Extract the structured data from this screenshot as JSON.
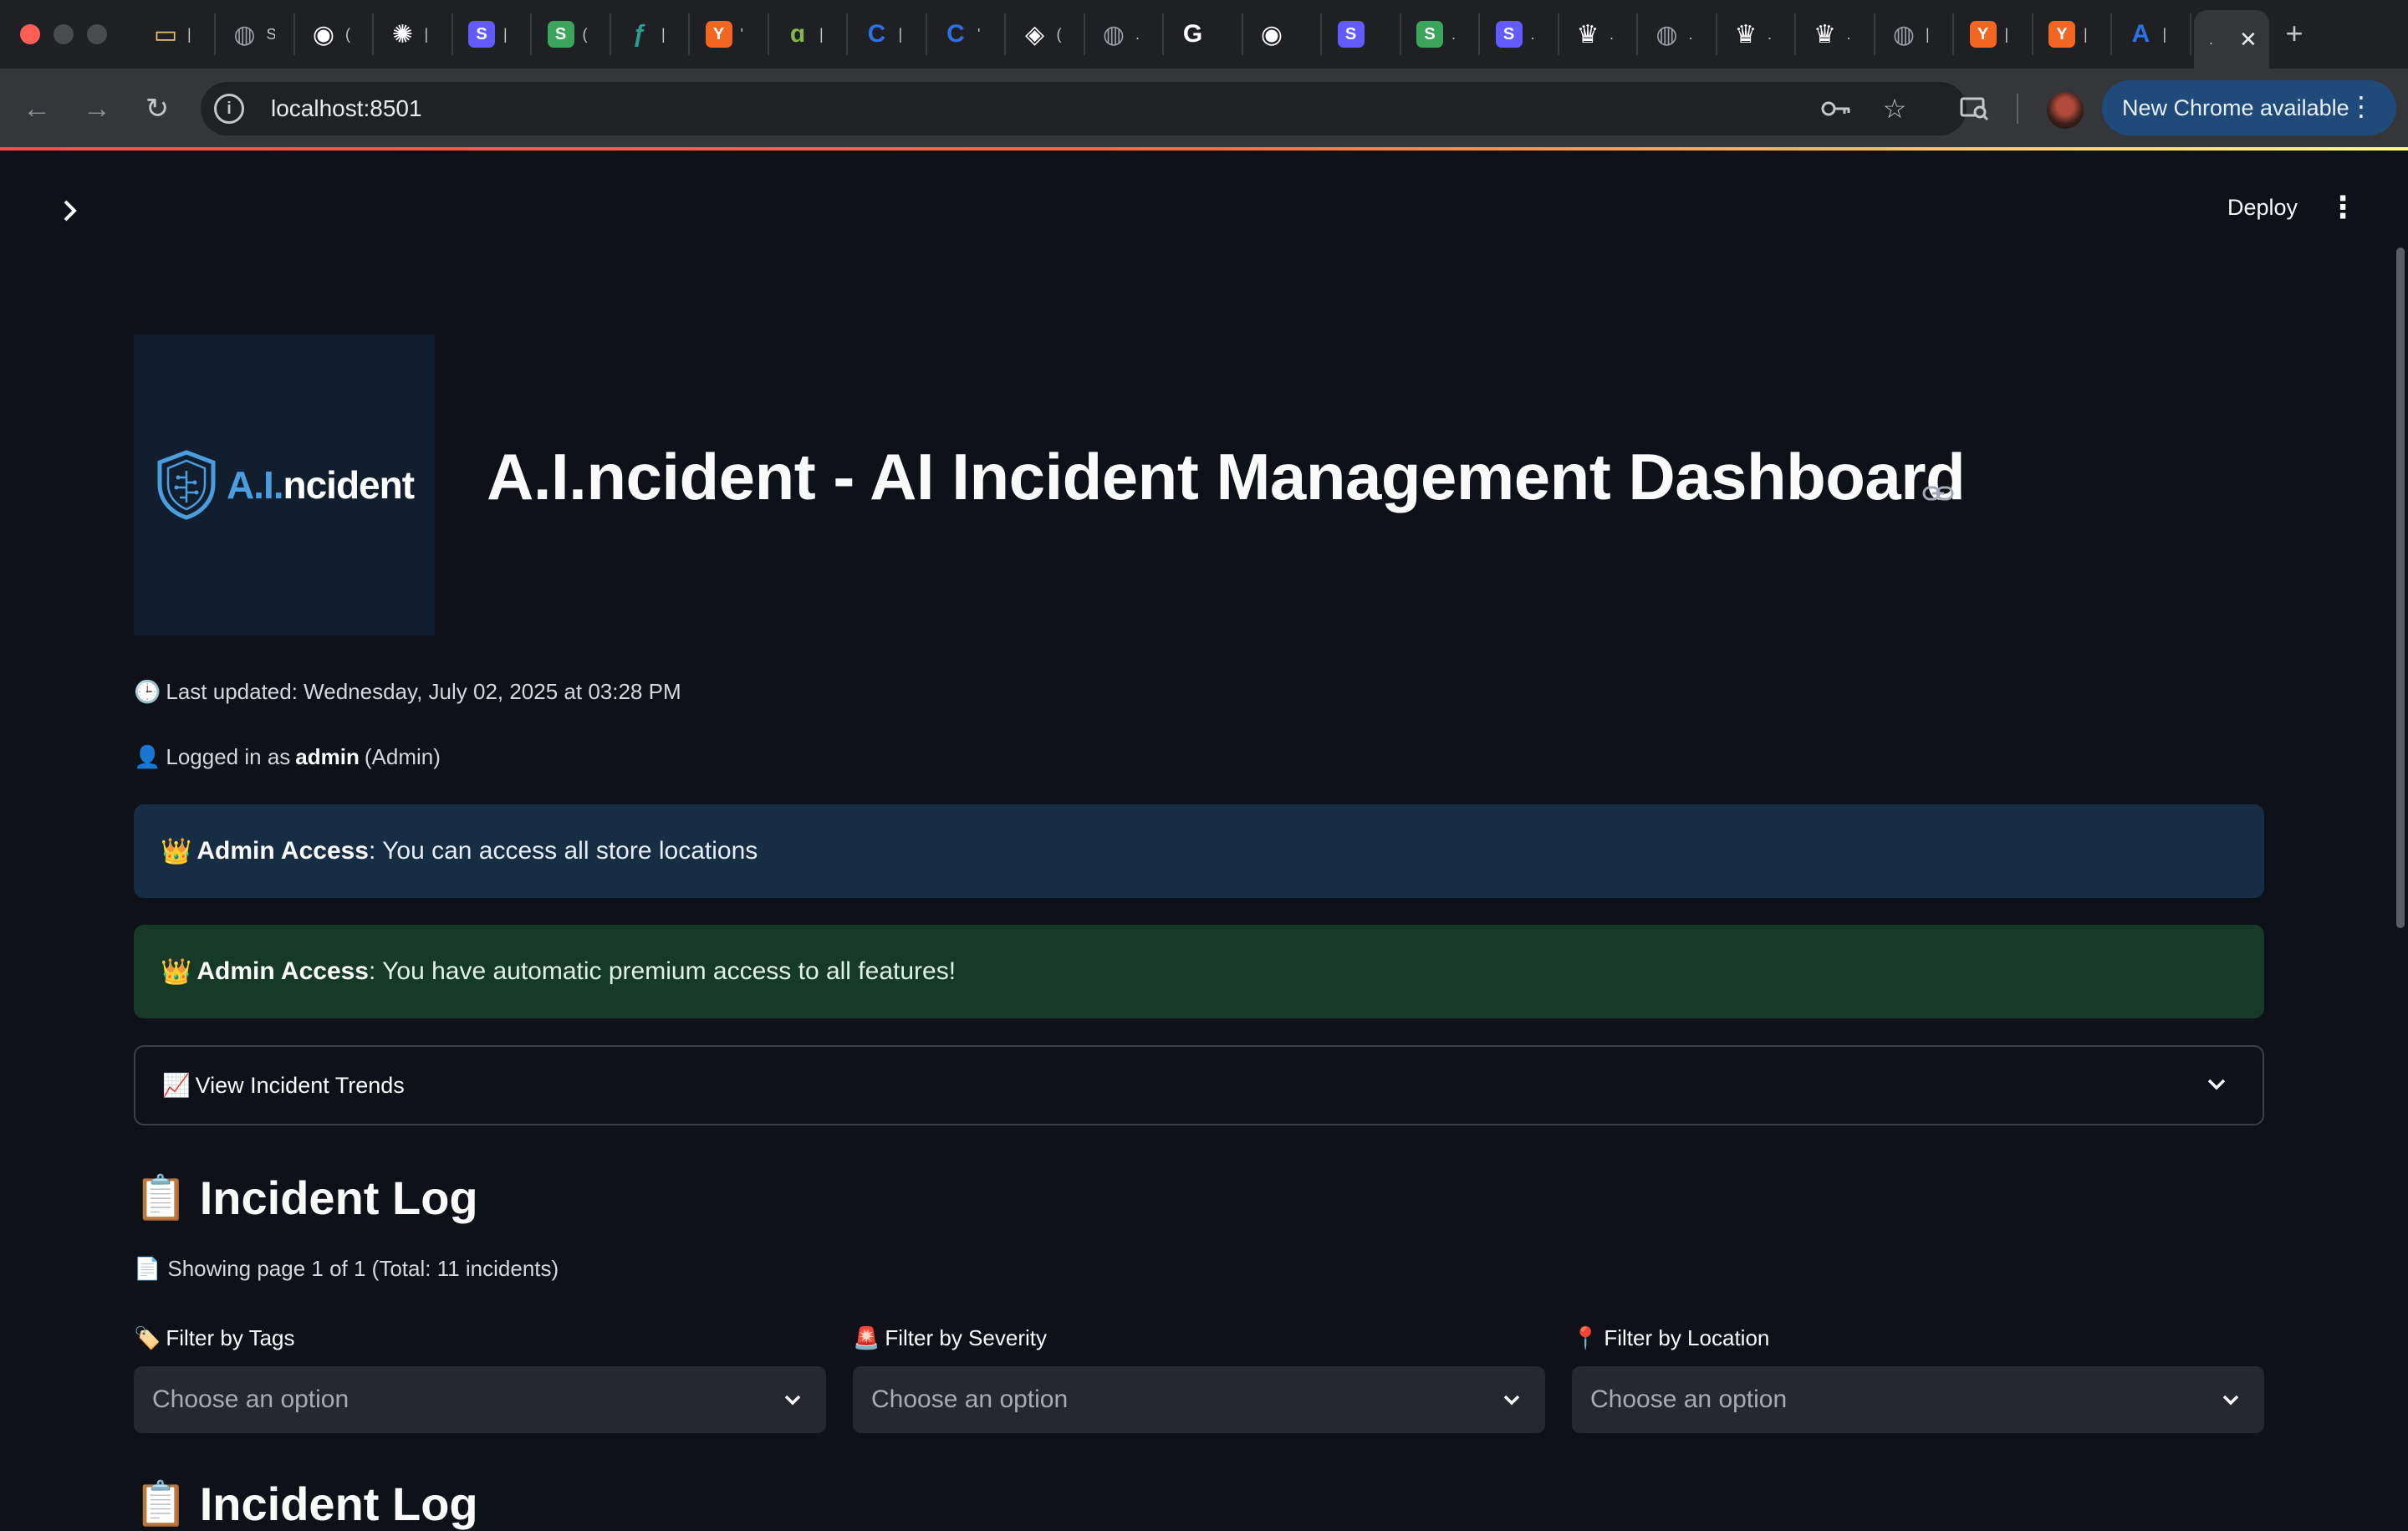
{
  "browser": {
    "tabs": [
      {
        "icon": "credit-card-icon",
        "color": "#e8c46a",
        "glyph": "▭",
        "title": "|"
      },
      {
        "icon": "globe-icon",
        "color": "#9aa0a6",
        "glyph": "◍",
        "title": "S"
      },
      {
        "icon": "github-icon",
        "color": "#ffffff",
        "glyph": "◉",
        "title": "("
      },
      {
        "icon": "openai-icon",
        "color": "#ffffff",
        "glyph": "✺",
        "title": "|"
      },
      {
        "icon": "s-brand-purple-icon",
        "color": "#635bff",
        "glyph": "S",
        "title": "|"
      },
      {
        "icon": "s-brand-green-icon",
        "color": "#3ba55c",
        "glyph": "S",
        "title": "("
      },
      {
        "icon": "feather-icon",
        "color": "#2a9d8f",
        "glyph": "ƒ",
        "title": "|"
      },
      {
        "icon": "y-combinator-icon",
        "color": "#f26522",
        "glyph": "Y",
        "title": "'"
      },
      {
        "icon": "leaf-icon",
        "color": "#84b84c",
        "glyph": "ɑ",
        "title": "|"
      },
      {
        "icon": "c-brand-icon",
        "color": "#2f6fe4",
        "glyph": "C",
        "title": "|"
      },
      {
        "icon": "c-brand-icon",
        "color": "#2f6fe4",
        "glyph": "C",
        "title": "'"
      },
      {
        "icon": "box-icon",
        "color": "#ffffff",
        "glyph": "◈",
        "title": "("
      },
      {
        "icon": "globe-icon",
        "color": "#9aa0a6",
        "glyph": "◍",
        "title": "."
      },
      {
        "icon": "google-icon",
        "color": "#ffffff",
        "glyph": "G",
        "title": ""
      },
      {
        "icon": "github-icon",
        "color": "#ffffff",
        "glyph": "◉",
        "title": ""
      },
      {
        "icon": "s-brand-purple-icon",
        "color": "#635bff",
        "glyph": "S",
        "title": ""
      },
      {
        "icon": "s-brand-green-icon",
        "color": "#3ba55c",
        "glyph": "S",
        "title": "."
      },
      {
        "icon": "s-brand-purple-icon",
        "color": "#635bff",
        "glyph": "S",
        "title": "."
      },
      {
        "icon": "crown-icon",
        "color": "#ffffff",
        "glyph": "♛",
        "title": "."
      },
      {
        "icon": "globe-icon",
        "color": "#9aa0a6",
        "glyph": "◍",
        "title": "."
      },
      {
        "icon": "crown-icon",
        "color": "#ffffff",
        "glyph": "♛",
        "title": "."
      },
      {
        "icon": "crown-icon",
        "color": "#ffffff",
        "glyph": "♛",
        "title": "."
      },
      {
        "icon": "globe-icon",
        "color": "#9aa0a6",
        "glyph": "◍",
        "title": "|"
      },
      {
        "icon": "y-combinator-icon",
        "color": "#f26522",
        "glyph": "Y",
        "title": "|"
      },
      {
        "icon": "y-combinator-icon",
        "color": "#f26522",
        "glyph": "Y",
        "title": "|"
      },
      {
        "icon": "app-store-icon",
        "color": "#2f6fe4",
        "glyph": "A",
        "title": "|"
      }
    ],
    "active_tab_title": ".",
    "url": "localhost:8501",
    "update_chip_label": "New Chrome available",
    "accent_color": "#1f4a7a"
  },
  "app": {
    "deploy_label": "Deploy",
    "logo": {
      "ai_text": "A.I.",
      "rest_text": "ncident"
    },
    "title": "A.I.ncident - AI Incident Management Dashboard",
    "last_updated": "Last updated: Wednesday, July 02, 2025 at 03:28 PM",
    "logged_in_prefix": "Logged in as",
    "logged_in_user": "admin",
    "logged_in_role": "(Admin)",
    "alert_info": {
      "emoji": "👑",
      "bold": "Admin Access",
      "text": ": You can access all store locations"
    },
    "alert_success": {
      "emoji": "👑",
      "bold": "Admin Access",
      "text": ": You have automatic premium access to all features!"
    },
    "expander_label": "View Incident Trends",
    "section_title": "Incident Log",
    "page_info": "Showing page 1 of 1 (Total: 11 incidents)",
    "filters": [
      {
        "label": "Filter by Tags",
        "emoji": "🏷️",
        "placeholder": "Choose an option"
      },
      {
        "label": "Filter by Severity",
        "emoji": "🚨",
        "placeholder": "Choose an option"
      },
      {
        "label": "Filter by Location",
        "emoji": "📍",
        "placeholder": "Choose an option"
      }
    ],
    "section_title_2": "Incident Log",
    "colors": {
      "background": "#0e1117",
      "info": "#172d43",
      "success": "#173928",
      "select": "#262730"
    }
  }
}
